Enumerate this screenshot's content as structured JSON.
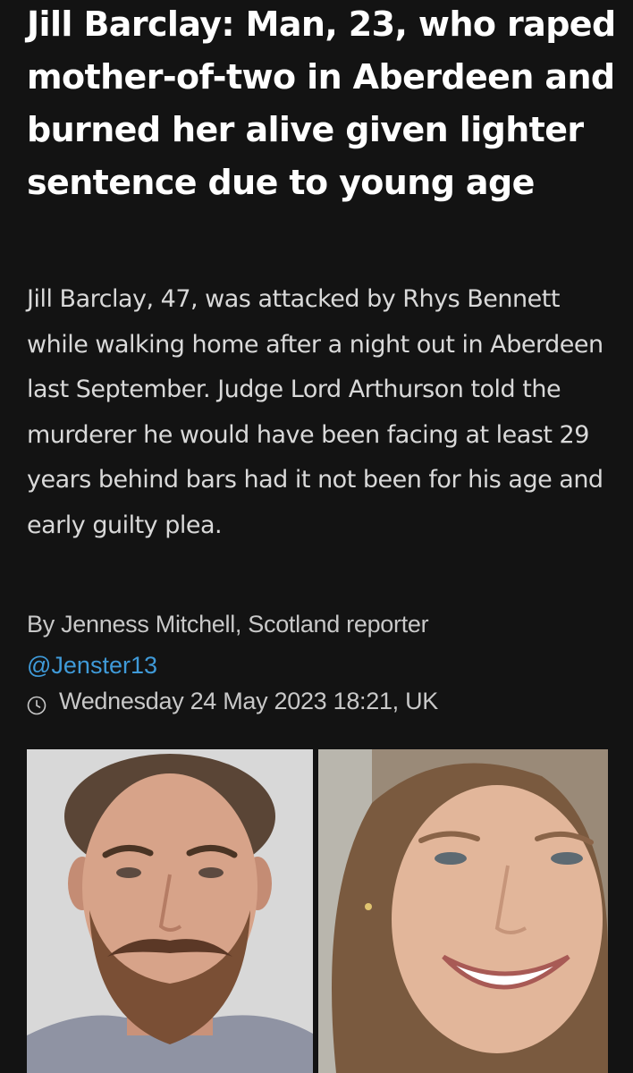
{
  "article": {
    "headline": "Jill Barclay: Man, 23, who raped mother-of-two in Aberdeen and burned her alive given lighter sentence due to young age",
    "standfirst": "Jill Barclay, 47, was attacked by Rhys Bennett while walking home after a night out in Aberdeen last September. Judge Lord Arthurson told the murderer he would have been facing at least 29 years behind bars had it not been for his age and early guilty plea.",
    "byline": "By Jenness Mitchell, Scotland reporter",
    "handle": "@Jenster13",
    "timestamp": "Wednesday 24 May 2023 18:21, UK",
    "timestamp_icon": "clock-icon"
  },
  "colors": {
    "background": "#131313",
    "headline": "#ffffff",
    "body_text": "#d9d9d9",
    "meta_text": "#c8c8c8",
    "link": "#3f9ad8"
  }
}
